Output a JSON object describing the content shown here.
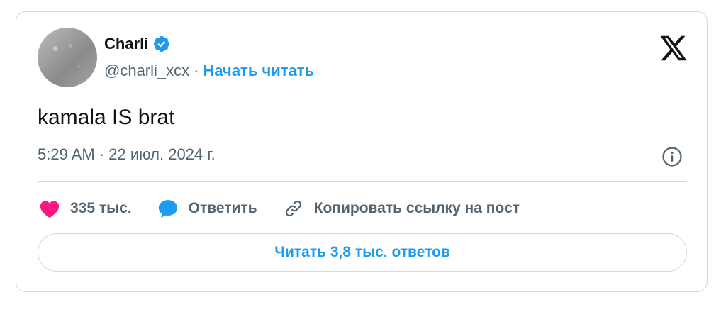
{
  "author": {
    "name": "Charli",
    "handle": "@charli_xcx",
    "separator": "·",
    "follow_label": "Начать читать"
  },
  "tweet": {
    "text": "kamala IS brat",
    "timestamp": "5:29 AM · 22 июл. 2024 г."
  },
  "actions": {
    "likes": "335 тыс.",
    "reply_label": "Ответить",
    "copy_link_label": "Копировать ссылку на пост"
  },
  "read_replies_label": "Читать 3,8 тыс. ответов",
  "colors": {
    "accent": "#1d9bf0",
    "like": "#f91880",
    "text_primary": "#0f1419",
    "text_secondary": "#536471",
    "border": "#cfd9de"
  },
  "icons": [
    "verified-badge-icon",
    "x-logo-icon",
    "info-icon",
    "heart-icon",
    "reply-bubble-icon",
    "link-icon"
  ]
}
